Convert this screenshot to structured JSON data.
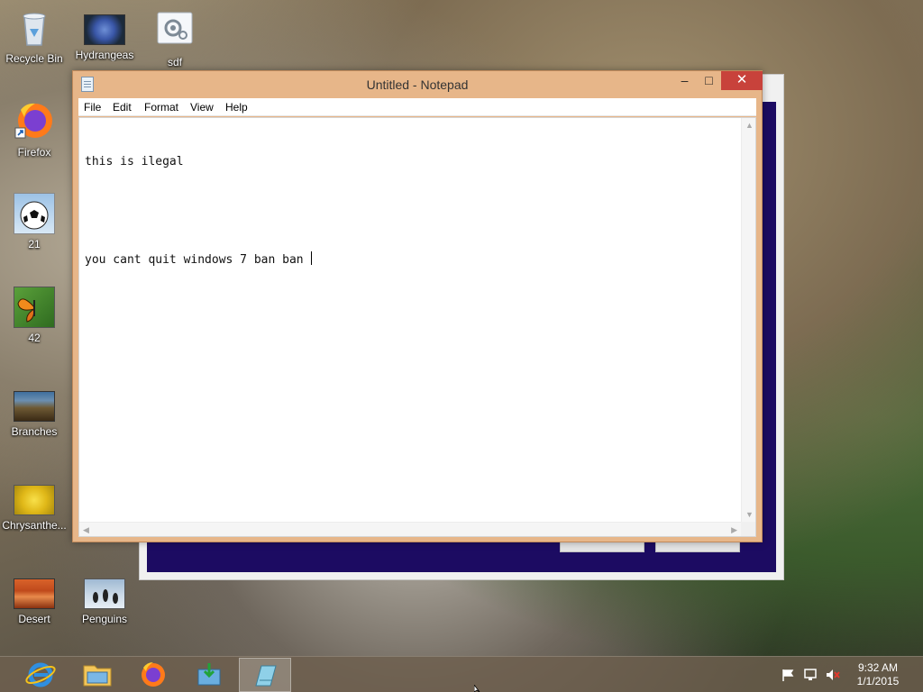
{
  "desktop": {
    "icons": [
      {
        "label": "Recycle Bin",
        "icon": "recycle-bin-icon"
      },
      {
        "label": "Hydrangeas",
        "icon": "image-thumbnail-icon"
      },
      {
        "label": "sdf",
        "icon": "settings-file-icon"
      },
      {
        "label": "Firefox",
        "icon": "firefox-icon"
      },
      {
        "label": "21",
        "icon": "soccer-ball-icon"
      },
      {
        "label": "42",
        "icon": "butterfly-icon"
      },
      {
        "label": "Branches",
        "icon": "image-thumbnail-icon"
      },
      {
        "label": "Chrysanthe...",
        "icon": "image-thumbnail-icon"
      },
      {
        "label": "Desert",
        "icon": "image-thumbnail-icon"
      },
      {
        "label": "Penguins",
        "icon": "image-thumbnail-icon"
      }
    ]
  },
  "notepad": {
    "title": "Untitled - Notepad",
    "buttons": {
      "minimize": "–",
      "maximize": "□",
      "close": "✕"
    },
    "menu": [
      "File",
      "Edit",
      "Format",
      "View",
      "Help"
    ],
    "content": {
      "line1": "this is ilegal",
      "line2": "",
      "line3": "you cant quit windows 7 ban ban "
    }
  },
  "taskbar": {
    "apps": [
      {
        "name": "Internet Explorer",
        "icon": "internet-explorer-icon"
      },
      {
        "name": "File Explorer",
        "icon": "file-explorer-icon"
      },
      {
        "name": "Firefox",
        "icon": "firefox-icon"
      },
      {
        "name": "Installer",
        "icon": "installer-icon"
      },
      {
        "name": "Notepad",
        "icon": "notepad-icon",
        "active": true
      }
    ],
    "tray": {
      "icons": [
        "action-center-flag-icon",
        "network-icon",
        "volume-muted-icon"
      ],
      "time": "9:32 AM",
      "date": "1/1/2015"
    }
  },
  "colors": {
    "titlebar": "#e7b689",
    "close_button": "#c8423b",
    "dialog_background": "#1c0b62"
  }
}
